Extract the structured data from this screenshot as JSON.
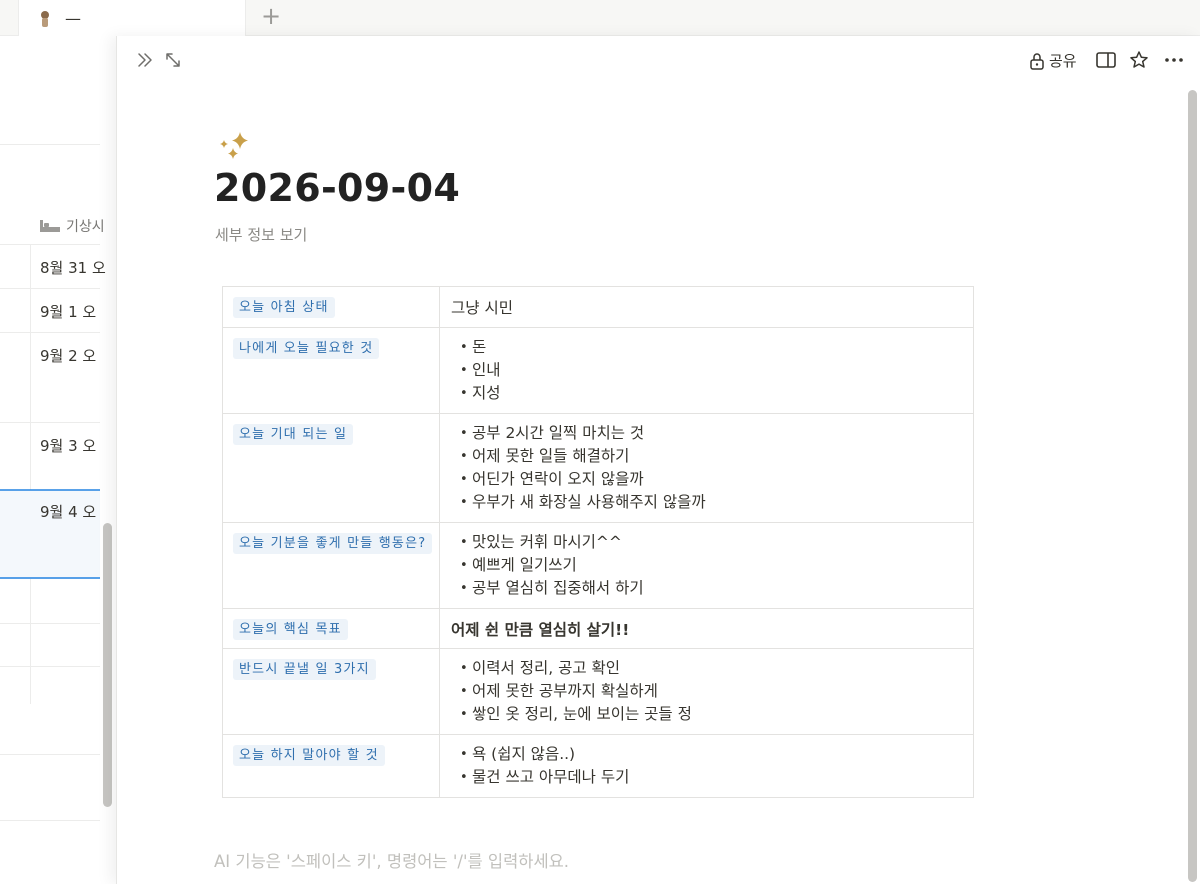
{
  "tabbar": {
    "tab_title": "—",
    "add_symbol": "+"
  },
  "background_db": {
    "column_header": "기상시",
    "rows": [
      "8월 31 오",
      "9월 1 오",
      "9월 2 오",
      "9월 3 오",
      "9월 4 오"
    ]
  },
  "peek": {
    "share_label": "공유",
    "page_icon": "sparkles-icon",
    "title": "2026-09-04",
    "details_link": "세부 정보 보기",
    "properties": [
      {
        "key": "오늘 아침 상태",
        "type": "text",
        "value": "그냥 시민"
      },
      {
        "key": "나에게 오늘 필요한 것",
        "type": "list",
        "items": [
          "돈",
          "인내",
          "지성"
        ]
      },
      {
        "key": "오늘 기대 되는 일",
        "type": "list",
        "items": [
          "공부 2시간 일찍 마치는 것",
          "어제 못한 일들 해결하기",
          "어딘가 연락이 오지 않을까",
          "우부가 새 화장실 사용해주지 않을까"
        ]
      },
      {
        "key": "오늘 기분을 좋게 만들 행동은?",
        "type": "list",
        "items": [
          "맛있는 커휘 마시기^^",
          "예쁘게 일기쓰기",
          "공부 열심히 집중해서 하기"
        ]
      },
      {
        "key": "오늘의 핵심 목표",
        "type": "bold",
        "value": "어제 쉰 만큼 열심히 살기!!"
      },
      {
        "key": "반드시 끝낼 일 3가지",
        "type": "list",
        "items": [
          "이력서 정리, 공고 확인",
          "어제 못한 공부까지 확실하게",
          "쌓인 옷 정리, 눈에 보이는 곳들 정"
        ]
      },
      {
        "key": "오늘 하지 말아야 할 것",
        "type": "list",
        "items": [
          "욕 (쉽지 않음..)",
          "물건 쓰고 아무데나 두기"
        ]
      }
    ],
    "editor_placeholder": "AI 기능은 '스페이스 키', 명령어는 '/'를 입력하세요."
  },
  "colors": {
    "tag_bg": "#edf3f9",
    "tag_text": "#2f6fae",
    "sparkle": "#c9a04a",
    "selection_line": "#2383e2"
  }
}
